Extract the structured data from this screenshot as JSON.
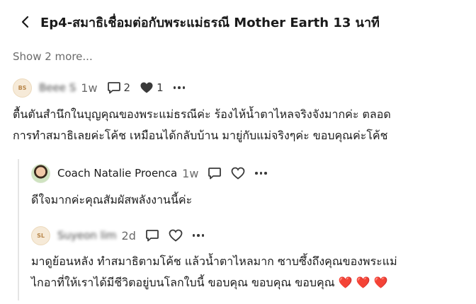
{
  "header": {
    "back_icon": "chevron-left-icon",
    "title": "Ep4-สมาธิเชื่อมต่อกับพระแม่ธรณี Mother Earth 13 นาที"
  },
  "show_more": "Show 2 more...",
  "comments": [
    {
      "avatar_initials": "BS",
      "username": "Beee S",
      "time": "1w",
      "reply_count": "2",
      "like_count": "1",
      "lines": [
        "ตื้นตันสำนึกในบุญคุณของพระแม่ธรณีค่ะ ร้องไห้น้ำตาไหลจริงจังมากค่ะ ตลอด",
        "การทำสมาธิเลยค่ะโค้ช เหมือนได้กลับบ้าน มายู่กับแม่จริงๆค่ะ ขอบคุณค่ะโค้ช"
      ]
    }
  ],
  "replies": [
    {
      "username": "Coach Natalie Proenca",
      "time": "1w",
      "lines": [
        "ดีใจมากค่ะคุณสัมผัสพลังงานนี้ค่ะ"
      ]
    },
    {
      "avatar_initials": "SL",
      "username": "Suyeon lim",
      "time": "2d",
      "lines": [
        "มาดูย้อนหลัง ทำสมาธิตามโค้ช แล้วน้ำตาไหลมาก ซาบซึ้งถึงคุณของพระแม่",
        "ไกอาที่ให้เราได้มีชีวิตอยู่บนโลกใบนี้ ขอบคุณ ขอบคุณ ขอบคุณ ❤️ ❤️ ❤️"
      ]
    }
  ],
  "icons": {
    "comment": "comment-bubble-icon",
    "like": "heart-icon",
    "more": "more-dots-icon"
  },
  "colors": {
    "text": "#1a1a1a",
    "muted": "#6b6b6b",
    "avatar_bg": "#f6ead8",
    "avatar_text": "#b8864a"
  }
}
